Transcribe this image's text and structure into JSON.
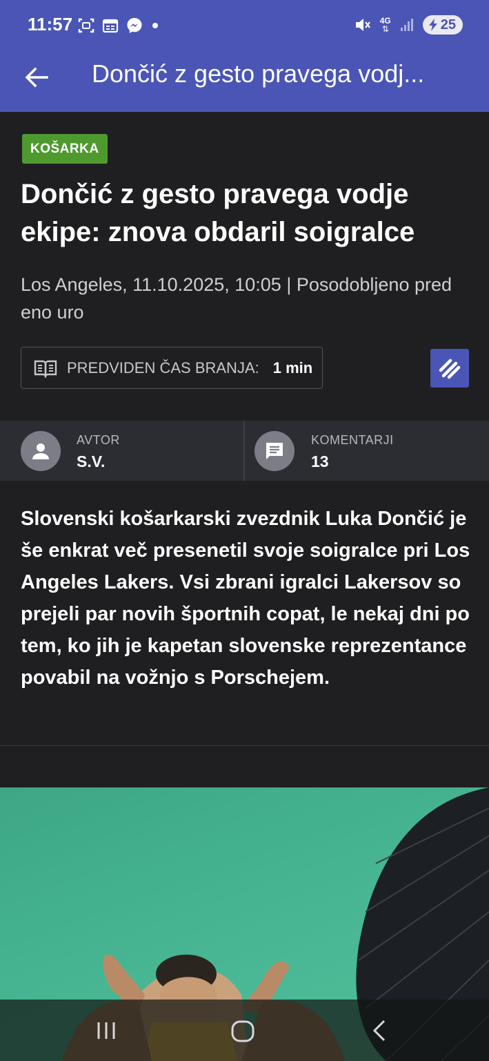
{
  "status_bar": {
    "time": "11:57",
    "network": "4G",
    "battery": "25",
    "icons": [
      "screenshot-icon",
      "calendar-icon",
      "messenger-icon",
      "dot-icon",
      "mute-icon",
      "network-4g-icon",
      "signal-icon",
      "battery-icon"
    ]
  },
  "app_bar": {
    "title": "Dončić z gesto pravega vodj..."
  },
  "article": {
    "category": "KOŠARKA",
    "title": "Dončić z gesto pravega vodje ekipe: znova obdaril soigralce",
    "meta": "Los Angeles, 11.10.2025, 10:05 | Posodobljeno pred eno uro",
    "read_time_label": "PREDVIDEN ČAS BRANJA:",
    "read_time_value": "1 min",
    "author_label": "AVTOR",
    "author_value": "S.V.",
    "comments_label": "KOMENTARJI",
    "comments_value": "13",
    "lead": "Slovenski košarkarski zvezdnik Luka Dončić je še enkrat več presenetil svoje soigralce pri Los Angeles Lakers. Vsi zbrani igralci Lakersov so prejeli par novih športnih copat, le nekaj dni po tem, ko jih je kapetan slovenske reprezentance povabil na vožnjo s Porschejem."
  },
  "colors": {
    "accent": "#4a55b5",
    "category_badge": "#4e9a2f",
    "background": "#1f1f21",
    "info_bar": "#2c2d33",
    "photo_backdrop": "#46b491"
  }
}
